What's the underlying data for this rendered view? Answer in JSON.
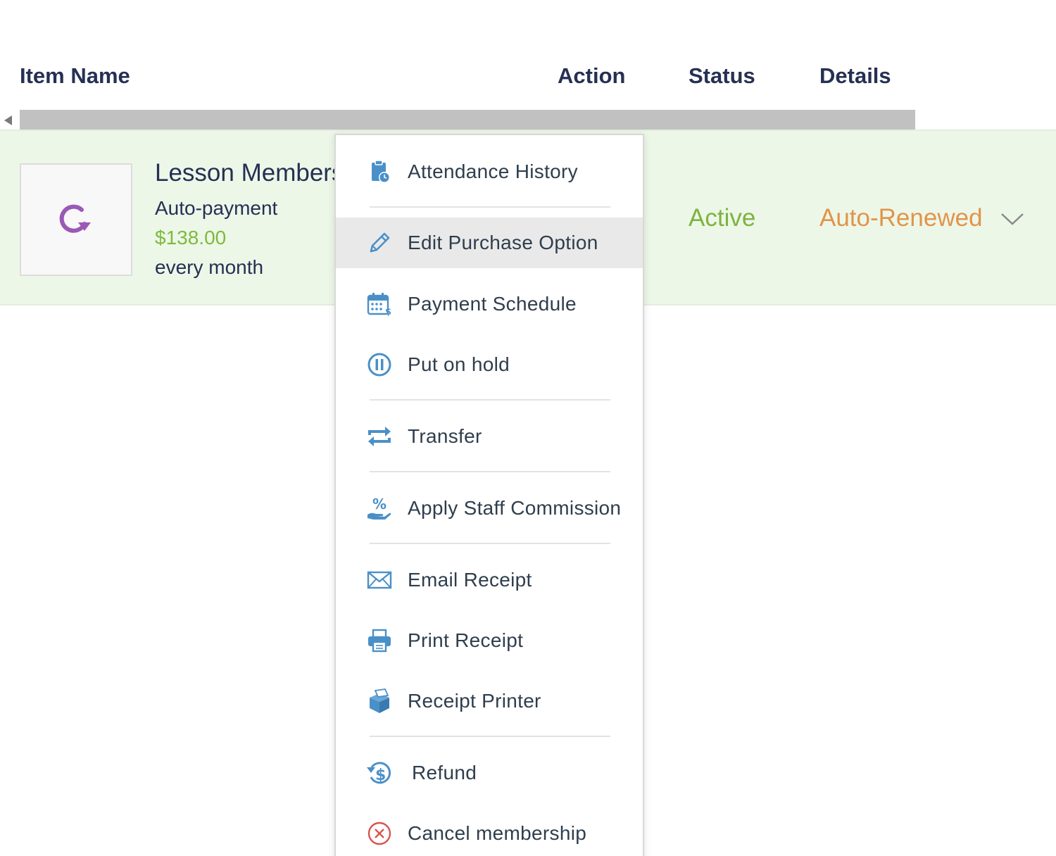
{
  "table": {
    "headers": {
      "item_name": "Item Name",
      "action": "Action",
      "status": "Status",
      "details": "Details"
    }
  },
  "row": {
    "name": "Lesson Membership",
    "payment_type": "Auto-payment",
    "price": "$138.00",
    "frequency": "every month",
    "status": "Active",
    "details": "Auto-Renewed",
    "thumbnail_icon": "renew-icon"
  },
  "menu": {
    "items": [
      {
        "label": "Attendance History",
        "icon": "clipboard-clock-icon"
      },
      {
        "label": "Edit Purchase Option",
        "icon": "pencil-icon",
        "highlighted": true
      },
      {
        "label": "Payment Schedule",
        "icon": "calendar-dollar-icon"
      },
      {
        "label": "Put on hold",
        "icon": "pause-icon"
      },
      {
        "label": "Transfer",
        "icon": "transfer-icon"
      },
      {
        "label": "Apply Staff Commission",
        "icon": "percent-hand-icon"
      },
      {
        "label": "Email Receipt",
        "icon": "envelope-icon"
      },
      {
        "label": "Print Receipt",
        "icon": "printer-icon"
      },
      {
        "label": "Receipt Printer",
        "icon": "box-printer-icon"
      },
      {
        "label": "Refund",
        "icon": "refund-icon"
      },
      {
        "label": "Cancel membership",
        "icon": "cancel-icon"
      }
    ]
  },
  "colors": {
    "header_text": "#253053",
    "row_background": "#edf7e8",
    "price_green": "#7dbb3d",
    "status_green": "#7db43f",
    "details_orange": "#e1944a",
    "icon_blue": "#4a90c8",
    "cancel_red": "#d9534f",
    "renew_purple": "#9b59b6"
  }
}
